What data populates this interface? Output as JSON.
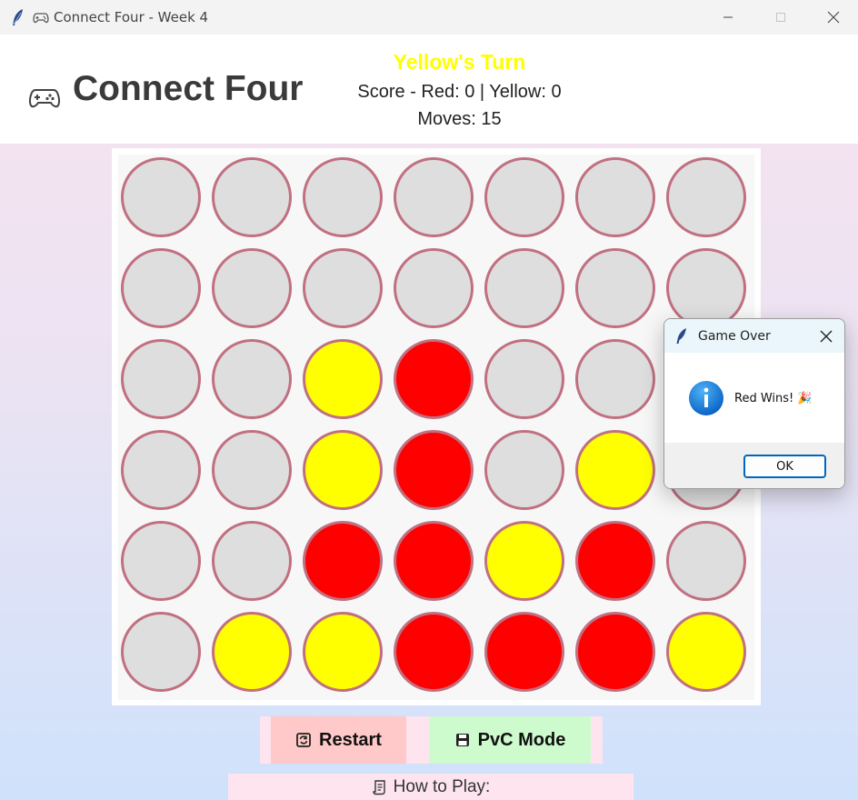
{
  "window": {
    "title": "Connect Four - Week 4",
    "app_icon": "feather-icon",
    "title_icon": "gamepad-icon"
  },
  "header": {
    "title": "Connect Four",
    "title_icon": "gamepad-icon",
    "turn": "Yellow's Turn",
    "turn_color": "#ffff00",
    "score": "Score - Red: 0 | Yellow: 0",
    "moves": "Moves: 15"
  },
  "colors": {
    "empty": "#dedede",
    "red": "#ff0000",
    "yellow": "#ffff00",
    "cell_border": "#c07080"
  },
  "board": {
    "rows": 6,
    "cols": 7,
    "cells": [
      [
        "empty",
        "empty",
        "empty",
        "empty",
        "empty",
        "empty",
        "empty"
      ],
      [
        "empty",
        "empty",
        "empty",
        "empty",
        "empty",
        "empty",
        "empty"
      ],
      [
        "empty",
        "empty",
        "yellow",
        "red",
        "empty",
        "empty",
        "empty"
      ],
      [
        "empty",
        "empty",
        "yellow",
        "red",
        "empty",
        "yellow",
        "empty"
      ],
      [
        "empty",
        "empty",
        "red",
        "red",
        "yellow",
        "red",
        "empty"
      ],
      [
        "empty",
        "yellow",
        "yellow",
        "red",
        "red",
        "red",
        "yellow"
      ]
    ]
  },
  "buttons": {
    "restart": {
      "label": "Restart",
      "icon": "restart-icon",
      "color": "#ffc9c9"
    },
    "pvc": {
      "label": "PvC Mode",
      "icon": "floppy-icon",
      "color": "#cdfbcd"
    }
  },
  "how_to": {
    "label": "How to Play:",
    "icon": "scroll-icon"
  },
  "dialog": {
    "title": "Game Over",
    "icon": "info-icon",
    "message": "Red Wins! 🎉",
    "ok_label": "OK"
  }
}
